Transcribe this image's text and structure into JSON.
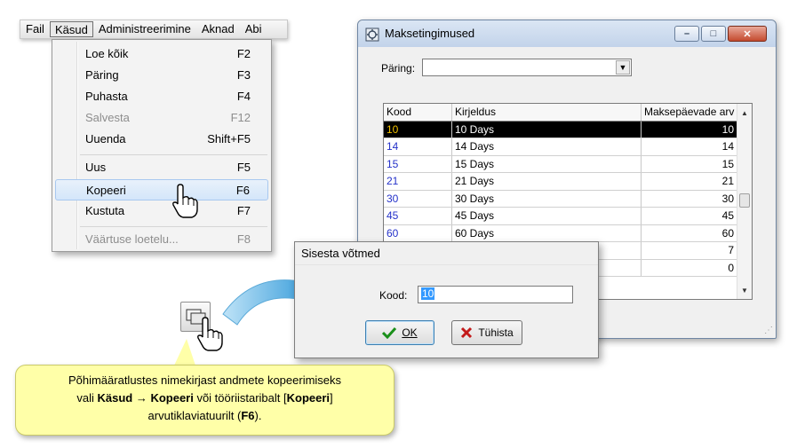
{
  "menubar": {
    "items": [
      "Fail",
      "Käsud",
      "Administreerimine",
      "Aknad",
      "Abi"
    ]
  },
  "dropdown": {
    "items": [
      {
        "label": "Loe kõik",
        "key": "F2"
      },
      {
        "label": "Päring",
        "key": "F3"
      },
      {
        "label": "Puhasta",
        "key": "F4"
      },
      {
        "label": "Salvesta",
        "key": "F12"
      },
      {
        "label": "Uuenda",
        "key": "Shift+F5"
      },
      {
        "label": "Uus",
        "key": "F5"
      },
      {
        "label": "Kopeeri",
        "key": "F6"
      },
      {
        "label": "Kustuta",
        "key": "F7"
      },
      {
        "label": "Väärtuse loetelu...",
        "key": "F8"
      }
    ]
  },
  "window": {
    "title": "Maksetingimused",
    "param_label": "Päring:",
    "param_value": "",
    "columns": [
      "Kood",
      "Kirjeldus",
      "Maksepäevade arv"
    ],
    "rows": [
      [
        "10",
        "10 Days",
        "10"
      ],
      [
        "14",
        "14 Days",
        "14"
      ],
      [
        "15",
        "15 Days",
        "15"
      ],
      [
        "21",
        "21 Days",
        "21"
      ],
      [
        "30",
        "30 Days",
        "30"
      ],
      [
        "45",
        "45 Days",
        "45"
      ],
      [
        "60",
        "60 Days",
        "60"
      ],
      [
        "",
        "",
        "7"
      ],
      [
        "",
        "",
        "0"
      ]
    ]
  },
  "dialog": {
    "title": "Sisesta võtmed",
    "kood_label": "Kood:",
    "kood_value": "10",
    "ok_label": "OK",
    "cancel_label": "Tühista"
  },
  "callout": {
    "line1": "Põhimääratlustes nimekirjast andmete kopeerimiseks",
    "line2_pre": "vali ",
    "line2_bold1": "Käsud → Kopeeri",
    "line2_mid": " või tööriistaribalt [",
    "line2_bold2": "Kopeeri",
    "line2_end": "]",
    "line3_pre": "arvutiklaviatuurilt (",
    "line3_bold": "F6",
    "line3_end": ")."
  }
}
